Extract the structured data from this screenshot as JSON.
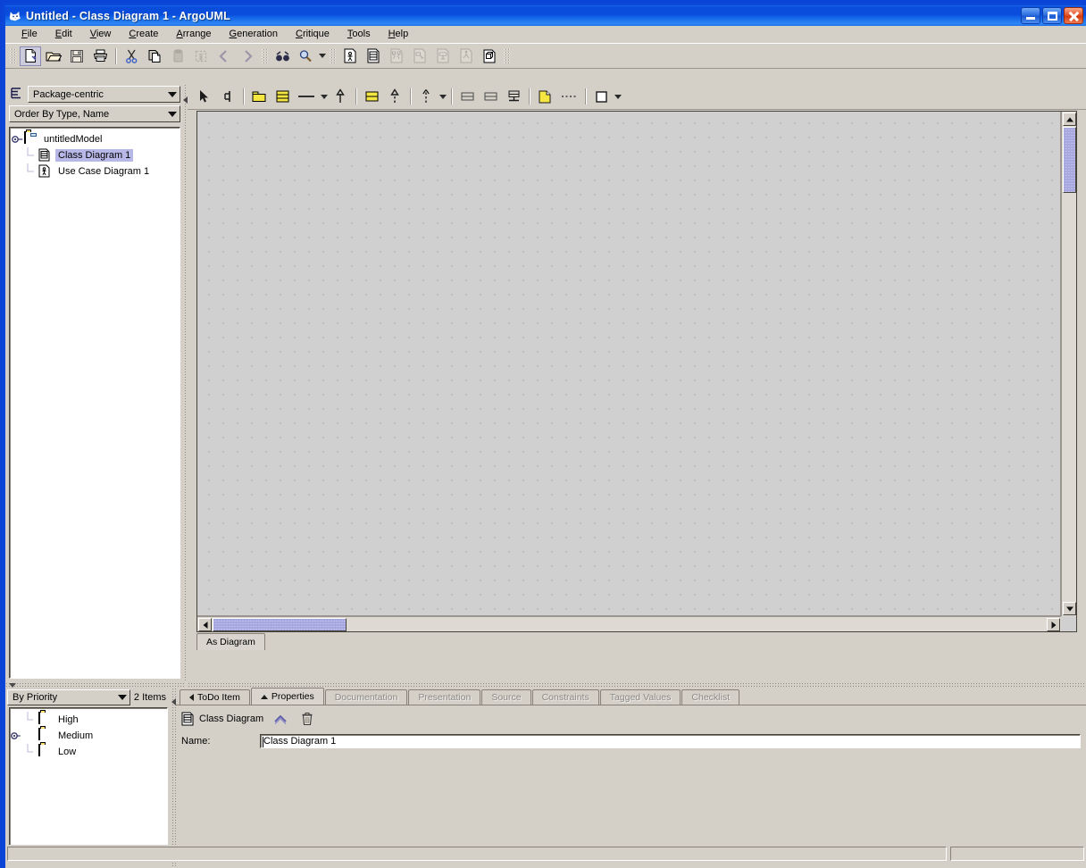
{
  "window": {
    "title": "Untitled - Class Diagram 1 - ArgoUML",
    "app_icon": "argouml-cat-icon",
    "buttons": {
      "minimize": "minimize-button",
      "maximize": "maximize-button",
      "close": "close-button"
    },
    "colors": {
      "title_bar": "#0a4ddc",
      "desktop_border": "#0a43d6",
      "face": "#d4d0c8",
      "canvas": "#d0d0d0",
      "selection": "#b8b8e8",
      "scroll_thumb": "#a8a8e0",
      "close_button": "#d23c12"
    }
  },
  "menubar": {
    "items": [
      {
        "label": "File",
        "mnemonic": "F"
      },
      {
        "label": "Edit",
        "mnemonic": "E"
      },
      {
        "label": "View",
        "mnemonic": "V"
      },
      {
        "label": "Create",
        "mnemonic": "C"
      },
      {
        "label": "Arrange",
        "mnemonic": "A"
      },
      {
        "label": "Generation",
        "mnemonic": "G"
      },
      {
        "label": "Critique",
        "mnemonic": "C"
      },
      {
        "label": "Tools",
        "mnemonic": "T"
      },
      {
        "label": "Help",
        "mnemonic": "H"
      }
    ]
  },
  "main_toolbar": {
    "items": [
      {
        "name": "new-icon",
        "tooltip": "New",
        "enabled": true,
        "selected": true
      },
      {
        "name": "open-icon",
        "tooltip": "Open Project",
        "enabled": true,
        "selected": false
      },
      {
        "name": "save-icon",
        "tooltip": "Save Project",
        "enabled": true,
        "selected": false
      },
      {
        "name": "print-icon",
        "tooltip": "Print",
        "enabled": true,
        "selected": false
      },
      {
        "name": "cut-icon",
        "tooltip": "Cut",
        "enabled": true,
        "selected": false
      },
      {
        "name": "copy-icon",
        "tooltip": "Copy",
        "enabled": true,
        "selected": false
      },
      {
        "name": "paste-icon",
        "tooltip": "Paste",
        "enabled": false,
        "selected": false
      },
      {
        "name": "delete-icon",
        "tooltip": "Remove From Model",
        "enabled": false,
        "selected": false
      },
      {
        "name": "navigate-back-icon",
        "tooltip": "Navigate Back",
        "enabled": false,
        "selected": false
      },
      {
        "name": "navigate-forward-icon",
        "tooltip": "Navigate Forward",
        "enabled": false,
        "selected": false
      },
      {
        "name": "find-icon",
        "tooltip": "Find",
        "enabled": true,
        "selected": false
      },
      {
        "name": "zoom-icon",
        "tooltip": "Zoom",
        "enabled": true,
        "selected": false
      },
      {
        "name": "new-usecase-diagram-icon",
        "tooltip": "New Use Case Diagram",
        "enabled": true,
        "selected": false
      },
      {
        "name": "new-class-diagram-icon",
        "tooltip": "New Class Diagram",
        "enabled": true,
        "selected": false
      },
      {
        "name": "new-sequence-diagram-icon",
        "tooltip": "New Sequence Diagram",
        "enabled": false,
        "selected": false
      },
      {
        "name": "new-collaboration-diagram-icon",
        "tooltip": "New Collaboration Diagram",
        "enabled": false,
        "selected": false
      },
      {
        "name": "new-state-diagram-icon",
        "tooltip": "New State Diagram",
        "enabled": false,
        "selected": false
      },
      {
        "name": "new-activity-diagram-icon",
        "tooltip": "New Activity Diagram",
        "enabled": false,
        "selected": false
      },
      {
        "name": "new-deployment-diagram-icon",
        "tooltip": "New Deployment Diagram",
        "enabled": true,
        "selected": false
      }
    ]
  },
  "diagram_toolbar": {
    "items": [
      {
        "name": "select-pointer-icon",
        "tooltip": "Select"
      },
      {
        "name": "broom-icon",
        "tooltip": "Broom"
      },
      {
        "name": "package-icon",
        "tooltip": "New Package"
      },
      {
        "name": "class-icon",
        "tooltip": "New Class"
      },
      {
        "name": "association-icon",
        "tooltip": "New Association",
        "has_dropdown": true
      },
      {
        "name": "generalization-icon",
        "tooltip": "New Generalization"
      },
      {
        "name": "interface-icon",
        "tooltip": "New Interface"
      },
      {
        "name": "realization-icon",
        "tooltip": "New Realization"
      },
      {
        "name": "dependency-icon",
        "tooltip": "New Dependency",
        "has_dropdown": true
      },
      {
        "name": "datatype-icon",
        "tooltip": "New Datatype"
      },
      {
        "name": "enumeration-icon",
        "tooltip": "New Enumeration"
      },
      {
        "name": "stereotype-icon",
        "tooltip": "New Stereotype"
      },
      {
        "name": "comment-icon",
        "tooltip": "New Comment"
      },
      {
        "name": "comment-link-icon",
        "tooltip": "New Comment Link"
      },
      {
        "name": "rectangle-icon",
        "tooltip": "Draw Rectangle",
        "has_dropdown": true
      }
    ]
  },
  "explorer": {
    "perspective_icon": "perspective-icon",
    "perspective": {
      "value": "Package-centric"
    },
    "ordering": {
      "value": "Order By Type, Name"
    },
    "tree": {
      "root": {
        "label": "untitledModel",
        "icon": "model-folder-icon",
        "expanded": true
      },
      "children": [
        {
          "label": "Class Diagram 1",
          "icon": "class-diagram-icon",
          "selected": true
        },
        {
          "label": "Use Case Diagram 1",
          "icon": "usecase-diagram-icon",
          "selected": false
        }
      ]
    }
  },
  "todo": {
    "sort": {
      "value": "By Priority"
    },
    "count_label": "2 Items",
    "items": [
      {
        "label": "High",
        "icon": "folder-icon",
        "expandable": false
      },
      {
        "label": "Medium",
        "icon": "folder-icon",
        "expandable": true
      },
      {
        "label": "Low",
        "icon": "folder-icon",
        "expandable": false
      }
    ]
  },
  "diagram": {
    "view_tabs": [
      {
        "label": "As Diagram",
        "active": true
      }
    ],
    "vertical_scrollbar": {
      "thumb_top_pct": 2,
      "thumb_height_pct": 13
    },
    "horizontal_scrollbar": {
      "thumb_left_pct": 0,
      "thumb_width_pct": 17
    }
  },
  "details": {
    "tabs": [
      {
        "label": "ToDo Item",
        "active": false,
        "enabled": true,
        "marker": "left-triangle"
      },
      {
        "label": "Properties",
        "active": true,
        "enabled": true,
        "marker": "up-triangle"
      },
      {
        "label": "Documentation",
        "active": false,
        "enabled": false,
        "marker": ""
      },
      {
        "label": "Presentation",
        "active": false,
        "enabled": false,
        "marker": ""
      },
      {
        "label": "Source",
        "active": false,
        "enabled": false,
        "marker": ""
      },
      {
        "label": "Constraints",
        "active": false,
        "enabled": false,
        "marker": ""
      },
      {
        "label": "Tagged Values",
        "active": false,
        "enabled": false,
        "marker": ""
      },
      {
        "label": "Checklist",
        "active": false,
        "enabled": false,
        "marker": ""
      }
    ],
    "properties": {
      "header_icon": "class-diagram-icon",
      "header_label": "Class Diagram",
      "navigate_up_icon": "navigate-up-icon",
      "delete_icon": "delete-trash-icon",
      "name_label": "Name:",
      "name_value": "Class Diagram 1"
    }
  },
  "statusbar": {
    "message": ""
  }
}
